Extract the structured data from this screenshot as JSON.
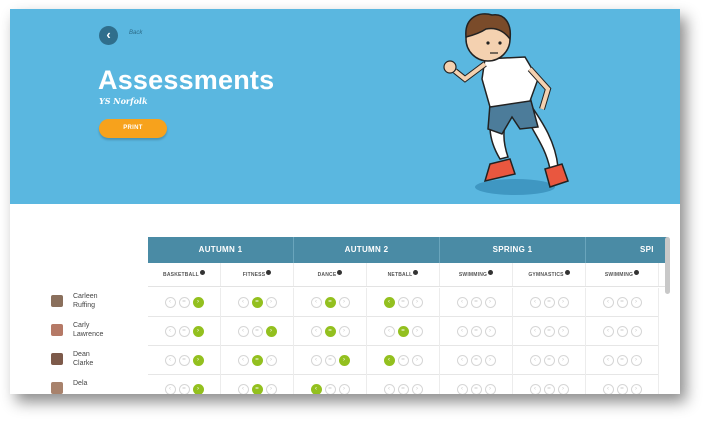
{
  "header": {
    "back_label": "Back",
    "title": "Assessments",
    "subtitle": "YS Norfolk",
    "print_label": "PRINT"
  },
  "terms": [
    {
      "label": "AUTUMN 1"
    },
    {
      "label": "AUTUMN 2"
    },
    {
      "label": "SPRING 1"
    },
    {
      "label": "SPI"
    }
  ],
  "subjects": [
    "BASKETBALL",
    "FITNESS",
    "DANCE",
    "NETBALL",
    "SWIMMING",
    "GYMNASTICS",
    "SWIMMING"
  ],
  "assessment_icons": [
    "chevron-left-icon",
    "equals-icon",
    "chevron-right-icon"
  ],
  "selected_color": "#93c01f",
  "students": [
    {
      "first": "Carleen",
      "last": "Ruffing",
      "grades": [
        "up",
        "eq",
        "eq",
        "down",
        "",
        "",
        ""
      ]
    },
    {
      "first": "Carly",
      "last": "Lawrence",
      "grades": [
        "up",
        "up",
        "eq",
        "eq",
        "",
        "",
        ""
      ]
    },
    {
      "first": "Dean",
      "last": "Clarke",
      "grades": [
        "up",
        "eq",
        "up",
        "down",
        "",
        "",
        ""
      ]
    },
    {
      "first": "Dela",
      "last": "",
      "grades": [
        "up",
        "eq",
        "down",
        "",
        "",
        "",
        ""
      ]
    }
  ]
}
